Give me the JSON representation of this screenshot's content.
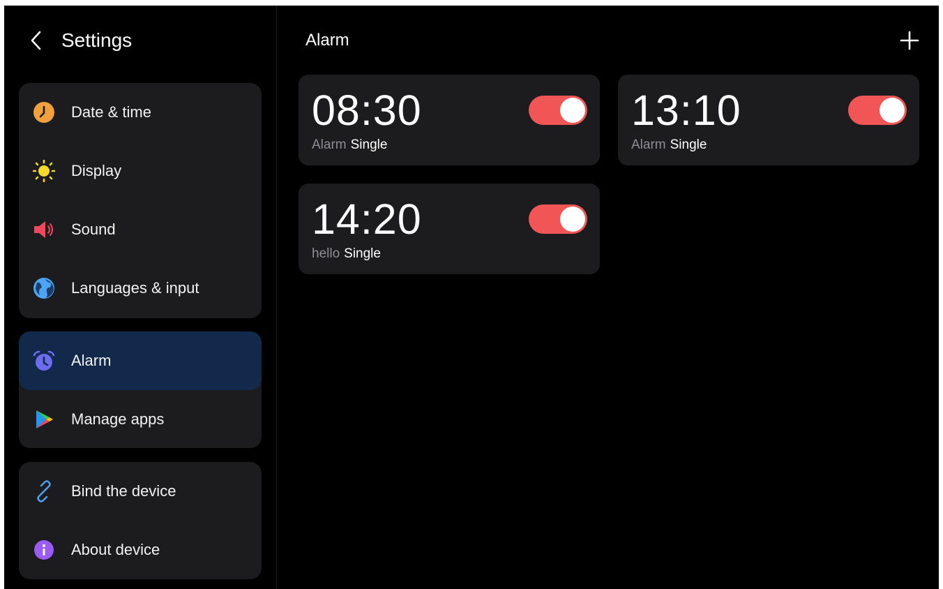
{
  "sidebar": {
    "title": "Settings",
    "groups": [
      {
        "items": [
          {
            "label": "Date & time",
            "icon": "clock-icon",
            "color": "#f0a03c"
          },
          {
            "label": "Display",
            "icon": "sun-icon",
            "color": "#f5d82a"
          },
          {
            "label": "Sound",
            "icon": "speaker-icon",
            "color": "#f0475d"
          },
          {
            "label": "Languages & input",
            "icon": "globe-icon",
            "color": "#4da3f5"
          }
        ]
      },
      {
        "items": [
          {
            "label": "Alarm",
            "icon": "alarm-clock-icon",
            "color": "#6c6cf0",
            "active": true
          },
          {
            "label": "Manage apps",
            "icon": "play-store-icon"
          }
        ]
      },
      {
        "items": [
          {
            "label": "Bind the device",
            "icon": "link-icon",
            "color": "#4da3f5"
          },
          {
            "label": "About device",
            "icon": "info-icon",
            "color": "#9b5cf6"
          }
        ]
      }
    ]
  },
  "main": {
    "title": "Alarm",
    "add_icon": "plus-icon",
    "alarms": [
      {
        "time": "08:30",
        "label": "Alarm",
        "repeat": "Single",
        "enabled": true
      },
      {
        "time": "13:10",
        "label": "Alarm",
        "repeat": "Single",
        "enabled": true
      },
      {
        "time": "14:20",
        "label": "hello",
        "repeat": "Single",
        "enabled": true
      }
    ]
  },
  "colors": {
    "background": "#000000",
    "card": "#1c1c1e",
    "active_item": "#13294b",
    "toggle_on": "#f25555",
    "secondary_text": "#8e8e93"
  }
}
